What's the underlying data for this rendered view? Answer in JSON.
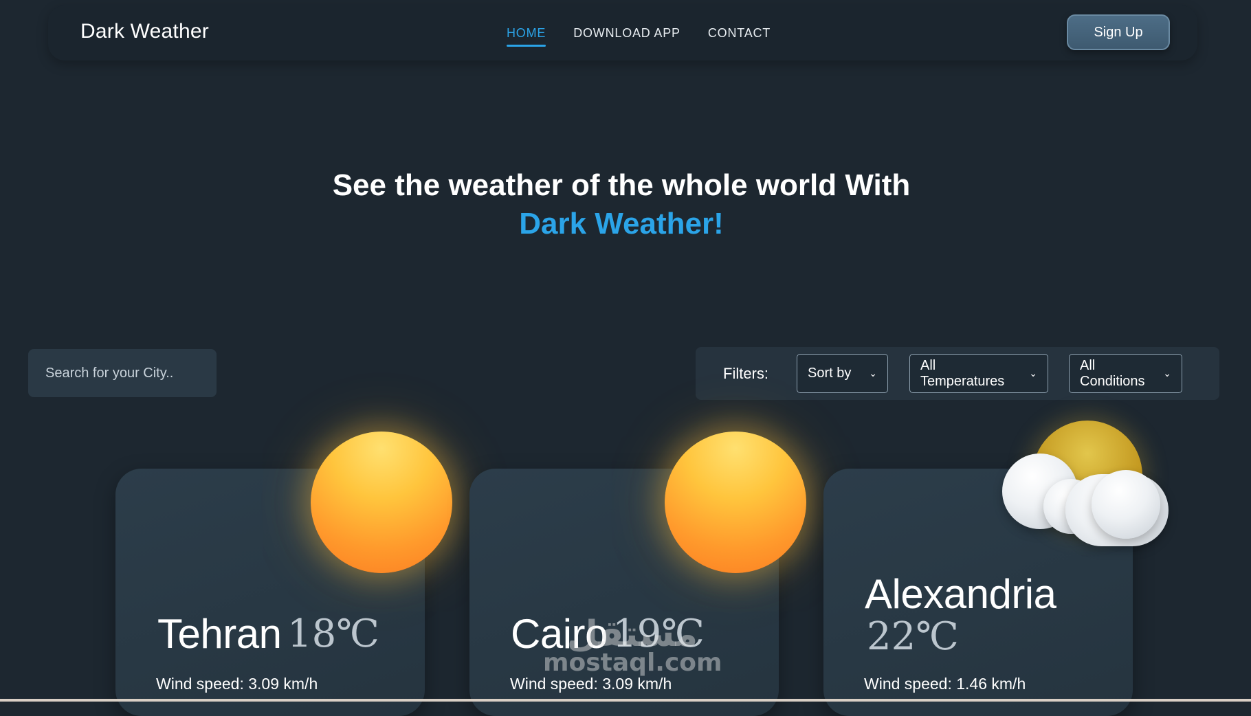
{
  "brand": "Dark Weather",
  "nav": {
    "links": [
      "HOME",
      "DOWNLOAD APP",
      "CONTACT"
    ],
    "active": "HOME"
  },
  "header": {
    "signup_label": "Sign Up"
  },
  "hero": {
    "line1": "See the weather of the whole world With",
    "line2": "Dark Weather!"
  },
  "search": {
    "placeholder": "Search for your City.."
  },
  "filters": {
    "label": "Filters:",
    "sort": "Sort by",
    "temperatures": "All Temperatures",
    "conditions": "All Conditions"
  },
  "cards": [
    {
      "city": "Tehran",
      "temp": "18℃",
      "wind": "Wind speed: 3.09 km/h",
      "icon": "sun-icon"
    },
    {
      "city": "Cairo",
      "temp": "19℃",
      "wind": "Wind speed: 3.09 km/h",
      "icon": "sun-icon"
    },
    {
      "city": "Alexandria",
      "temp": "22℃",
      "wind": "Wind speed: 1.46 km/h",
      "icon": "partly-cloudy-icon"
    }
  ],
  "watermark": {
    "arabic": "مستقل",
    "latin": "mostaql.com"
  },
  "colors": {
    "background": "#1d2730",
    "accent": "#2ba4e8",
    "card": "#2a3a46",
    "button": "#456279"
  }
}
